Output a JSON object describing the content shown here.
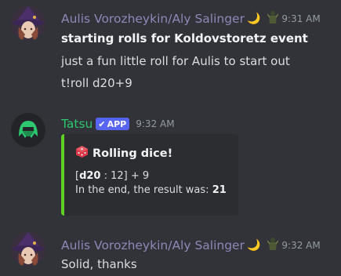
{
  "messages": [
    {
      "author": "Aulis Vorozheykin/Aly Salinger",
      "status_emoji": "🌙",
      "role_icon": "dark-figure-icon",
      "timestamp": "9:31 AM",
      "lines": [
        "starting rolls for Koldovstoretz event",
        "just a fun little roll for Aulis to start out",
        "t!roll d20+9"
      ]
    },
    {
      "author": "Tatsu",
      "badge": "APP",
      "badge_check": "✔",
      "timestamp": "9:32 AM",
      "embed": {
        "title": "Rolling dice!",
        "roll_die": "d20",
        "roll_detail": " : 12] + 9",
        "roll_open": "[",
        "result_prefix": "In the end, the result was: ",
        "result_value": "21",
        "accent_color": "#5ed127"
      }
    },
    {
      "author": "Aulis Vorozheykin/Aly Salinger",
      "status_emoji": "🌙",
      "role_icon": "dark-figure-icon",
      "timestamp": "9:32 AM",
      "lines": [
        "Solid, thanks"
      ]
    }
  ],
  "colors": {
    "background": "#313338",
    "aulis_name": "#8f87b7",
    "tatsu_name": "#2dc770",
    "app_badge": "#5865f2"
  }
}
